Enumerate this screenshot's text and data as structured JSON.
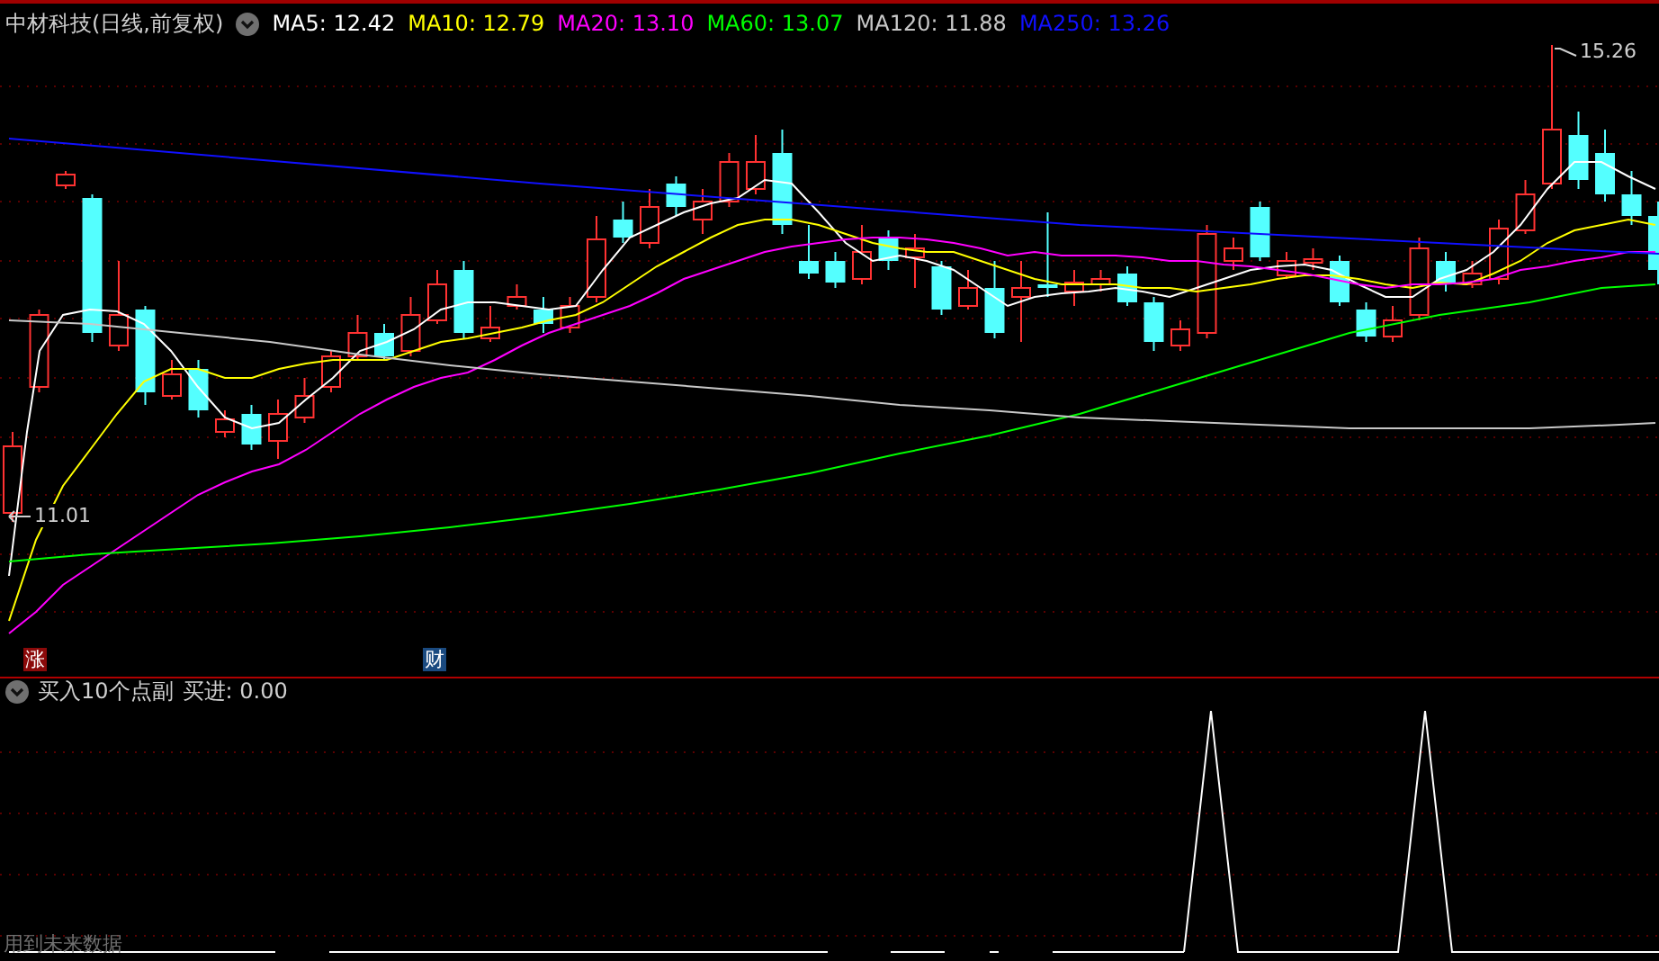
{
  "title": "中材科技(日线,前复权)",
  "moving_averages": [
    {
      "label": "MA5: 12.42",
      "color": "#ffffff"
    },
    {
      "label": "MA10: 12.79",
      "color": "#ffff00"
    },
    {
      "label": "MA20: 13.10",
      "color": "#ff00ff"
    },
    {
      "label": "MA60: 13.07",
      "color": "#00ff00"
    },
    {
      "label": "MA120: 11.88",
      "color": "#c8c8c8"
    },
    {
      "label": "MA250: 13.26",
      "color": "#1010ff"
    }
  ],
  "price_markers": [
    {
      "kind": "low",
      "text": "11.01"
    },
    {
      "kind": "high",
      "text": "15.26"
    }
  ],
  "badges": [
    {
      "text": "涨",
      "color": "#8b0a0a"
    },
    {
      "text": "财",
      "color": "#1a4a80"
    }
  ],
  "indicator": {
    "name": "买入10个点副",
    "reading": "买进: 0.00"
  },
  "warning": "用到未来数据"
}
